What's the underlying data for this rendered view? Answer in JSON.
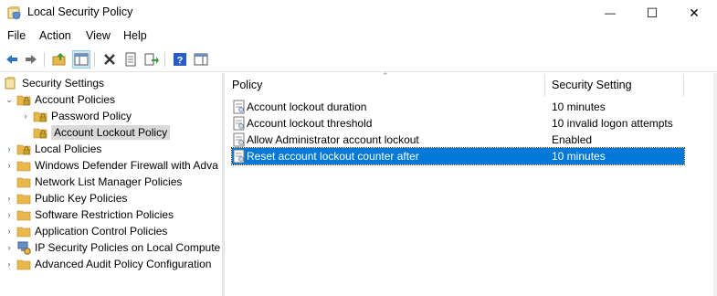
{
  "window": {
    "title": "Local Security Policy",
    "minimize_glyph": "—",
    "maximize_glyph": "☐",
    "close_glyph": "✕"
  },
  "menu": [
    "File",
    "Action",
    "View",
    "Help"
  ],
  "toolbar": {
    "buttons": [
      "back-icon",
      "forward-icon",
      "up-folder-icon",
      "show-hide-tree-icon",
      "delete-icon",
      "properties-icon",
      "export-list-icon",
      "help-icon",
      "show-action-pane-icon"
    ]
  },
  "tree": {
    "root": "Security Settings",
    "nodes": [
      {
        "label": "Account Policies",
        "expanded": true
      },
      {
        "label": "Password Policy"
      },
      {
        "label": "Account Lockout Policy",
        "selected": true
      },
      {
        "label": "Local Policies"
      },
      {
        "label": "Windows Defender Firewall with Adva"
      },
      {
        "label": "Network List Manager Policies"
      },
      {
        "label": "Public Key Policies"
      },
      {
        "label": "Software Restriction Policies"
      },
      {
        "label": "Application Control Policies"
      },
      {
        "label": "IP Security Policies on Local Compute"
      },
      {
        "label": "Advanced Audit Policy Configuration"
      }
    ]
  },
  "list": {
    "columns": [
      "Policy",
      "Security Setting"
    ],
    "rows": [
      {
        "policy": "Account lockout duration",
        "setting": "10 minutes"
      },
      {
        "policy": "Account lockout threshold",
        "setting": "10 invalid logon attempts"
      },
      {
        "policy": "Allow Administrator account lockout",
        "setting": "Enabled"
      },
      {
        "policy": "Reset account lockout counter after",
        "setting": "10 minutes",
        "selected": true
      }
    ]
  },
  "colors": {
    "selection": "#0078d7",
    "tree_selection": "#d9d9d9",
    "folder": "#e8b84a"
  }
}
